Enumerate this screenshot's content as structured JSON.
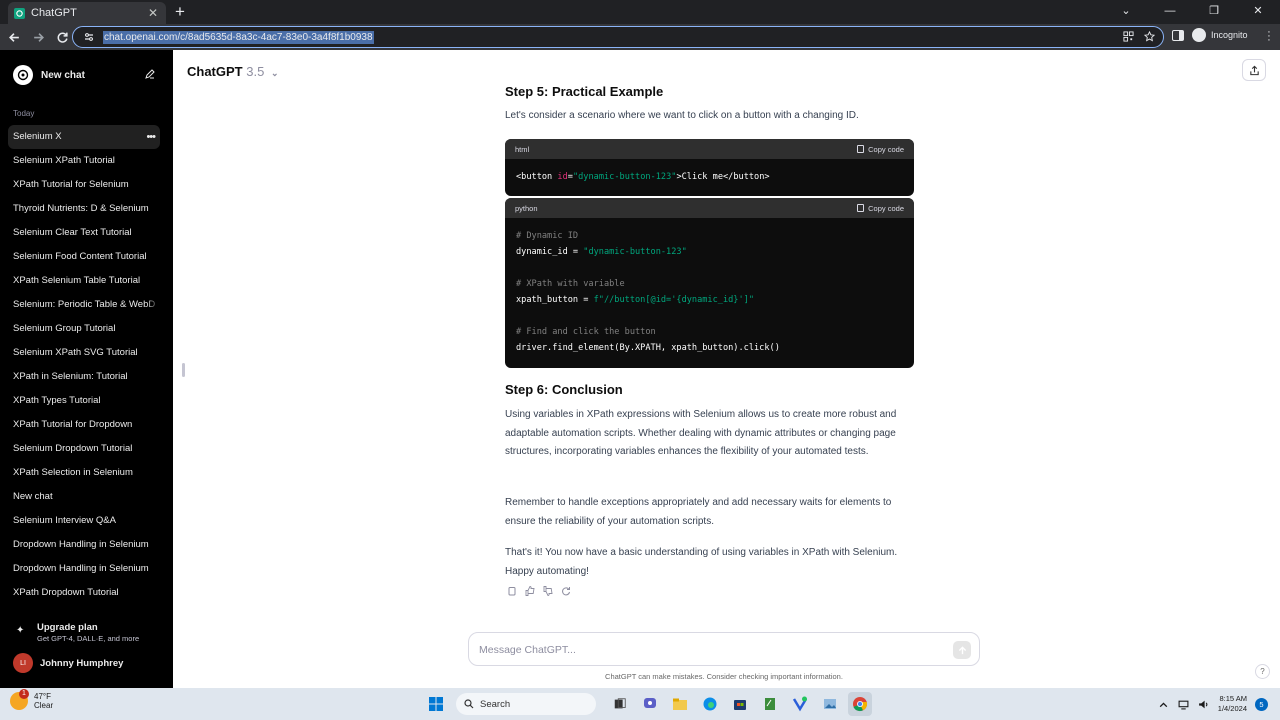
{
  "browser": {
    "tab_title": "ChatGPT",
    "url": "chat.openai.com/c/8ad5635d-8a3c-4ac7-83e0-3a4f8f1b0938",
    "profile_label": "Incognito"
  },
  "sidebar": {
    "new_chat_label": "New chat",
    "section_label": "Today",
    "items": [
      {
        "label": "Selenium X"
      },
      {
        "label": "Selenium XPath Tutorial"
      },
      {
        "label": "XPath Tutorial for Selenium"
      },
      {
        "label": "Thyroid Nutrients: D & Selenium"
      },
      {
        "label": "Selenium Clear Text Tutorial"
      },
      {
        "label": "Selenium Food Content Tutorial"
      },
      {
        "label": "XPath Selenium Table Tutorial"
      },
      {
        "label": "Selenium: Periodic Table & WebD"
      },
      {
        "label": "Selenium Group Tutorial"
      },
      {
        "label": "Selenium XPath SVG Tutorial"
      },
      {
        "label": "XPath in Selenium: Tutorial"
      },
      {
        "label": "XPath Types Tutorial"
      },
      {
        "label": "XPath Tutorial for Dropdown"
      },
      {
        "label": "Selenium Dropdown Tutorial"
      },
      {
        "label": "XPath Selection in Selenium"
      },
      {
        "label": "New chat"
      },
      {
        "label": "Selenium Interview Q&A"
      },
      {
        "label": "Dropdown Handling in Selenium"
      },
      {
        "label": "Dropdown Handling in Selenium"
      },
      {
        "label": "XPath Dropdown Tutorial"
      }
    ],
    "upgrade_title": "Upgrade plan",
    "upgrade_subtitle": "Get GPT-4, DALL·E, and more",
    "user_initials": "LI",
    "user_name": "Johnny Humphrey"
  },
  "header": {
    "model_name": "ChatGPT",
    "model_version": "3.5"
  },
  "chat": {
    "step5_heading": "Step 5: Practical Example",
    "step5_intro": "Let's consider a scenario where we want to click on a button with a changing ID.",
    "copy_label": "Copy code",
    "code_html_lang": "html",
    "code_html": {
      "tag_open": "<button ",
      "attr": "id",
      "eq": "=",
      "value": "\"dynamic-button-123\"",
      "rest": ">Click me</button>"
    },
    "code_python_lang": "python",
    "code_python": {
      "c1": "# Dynamic ID",
      "l2_pre": "dynamic_id = ",
      "l2_str": "\"dynamic-button-123\"",
      "c3": "# XPath with variable",
      "l4_pre": "xpath_button = ",
      "l4_str": "f\"//button[@id='{dynamic_id}']\"",
      "c5": "# Find and click the button",
      "l6": "driver.find_element(By.XPATH, xpath_button).click()"
    },
    "step6_heading": "Step 6: Conclusion",
    "para1": "Using variables in XPath expressions with Selenium allows us to create more robust and adaptable automation scripts. Whether dealing with dynamic attributes or changing page structures, incorporating variables enhances the flexibility of your automated tests.",
    "para2": "Remember to handle exceptions appropriately and add necessary waits for elements to ensure the reliability of your automation scripts.",
    "para3": "That's it! You now have a basic understanding of using variables in XPath with Selenium. Happy automating!"
  },
  "composer": {
    "placeholder": "Message ChatGPT...",
    "disclaimer": "ChatGPT can make mistakes. Consider checking important information.",
    "help_label": "?"
  },
  "taskbar": {
    "weather_badge": "1",
    "temperature": "47°F",
    "condition": "Clear",
    "search_label": "Search",
    "time": "8:15 AM",
    "date": "1/4/2024",
    "notification_count": "5"
  }
}
